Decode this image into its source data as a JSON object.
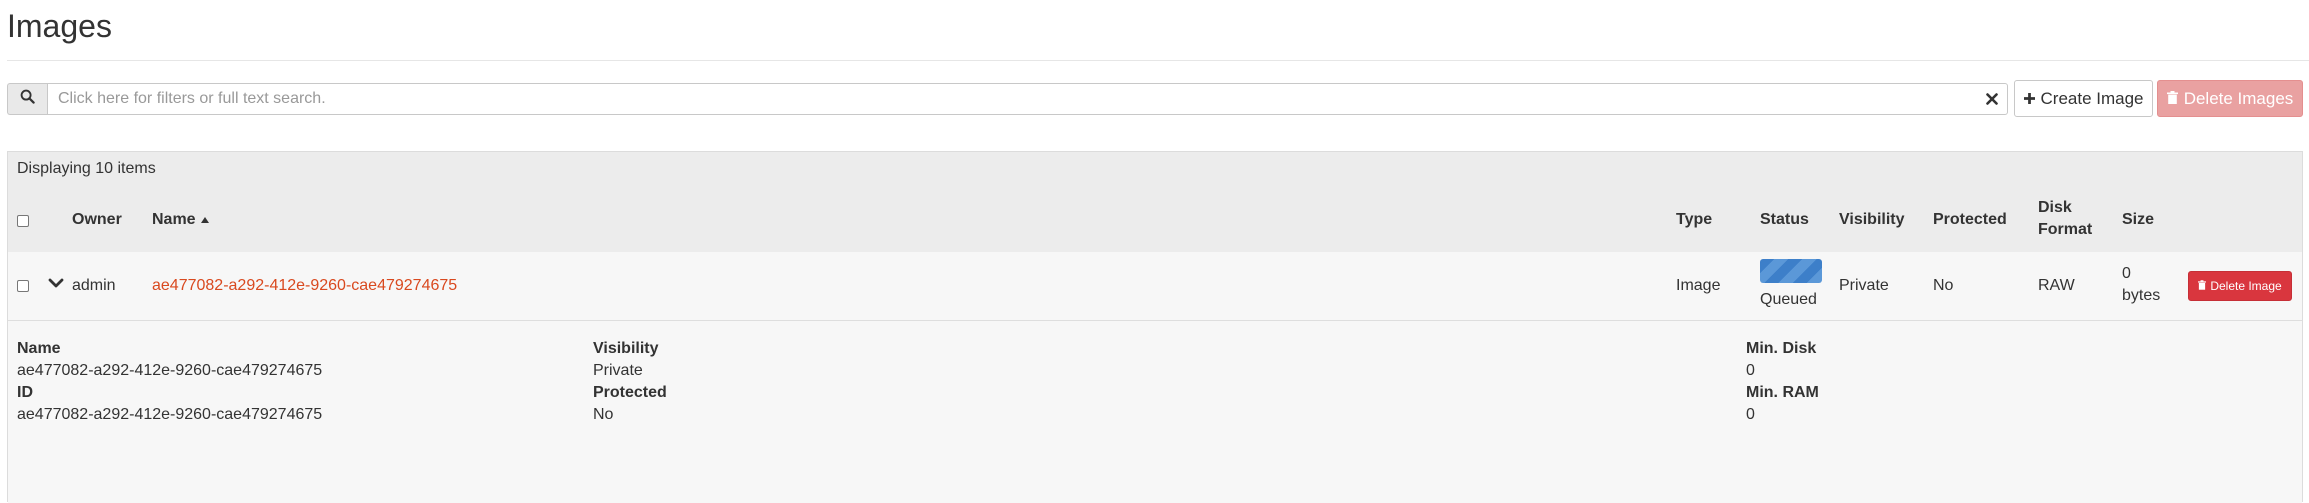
{
  "page": {
    "title": "Images"
  },
  "search": {
    "placeholder": "Click here for filters or full text search."
  },
  "toolbar": {
    "create_label": "Create Image",
    "delete_label": "Delete Images"
  },
  "table": {
    "count": "Displaying 10 items",
    "headers": {
      "owner": "Owner",
      "name": "Name",
      "type": "Type",
      "status": "Status",
      "visibility": "Visibility",
      "protected": "Protected",
      "disk_format_line1": "Disk",
      "disk_format_line2": "Format",
      "size": "Size"
    },
    "rows": [
      {
        "owner": "admin",
        "name": "ae477082-a292-412e-9260-cae479274675",
        "type": "Image",
        "status": "Queued",
        "visibility": "Private",
        "protected": "No",
        "disk_format": "RAW",
        "size_line1": "0",
        "size_line2": "bytes",
        "action_label": "Delete Image"
      }
    ]
  },
  "detail": {
    "name_label": "Name",
    "name_value": "ae477082-a292-412e-9260-cae479274675",
    "id_label": "ID",
    "id_value": "ae477082-a292-412e-9260-cae479274675",
    "visibility_label": "Visibility",
    "visibility_value": "Private",
    "protected_label": "Protected",
    "protected_value": "No",
    "min_disk_label": "Min. Disk",
    "min_disk_value": "0",
    "min_ram_label": "Min. RAM",
    "min_ram_value": "0"
  },
  "colors": {
    "link": "#d9491f",
    "danger": "#d9363e",
    "danger_disabled": "#e9a1a1",
    "status_bar": "#3d7fc9"
  }
}
